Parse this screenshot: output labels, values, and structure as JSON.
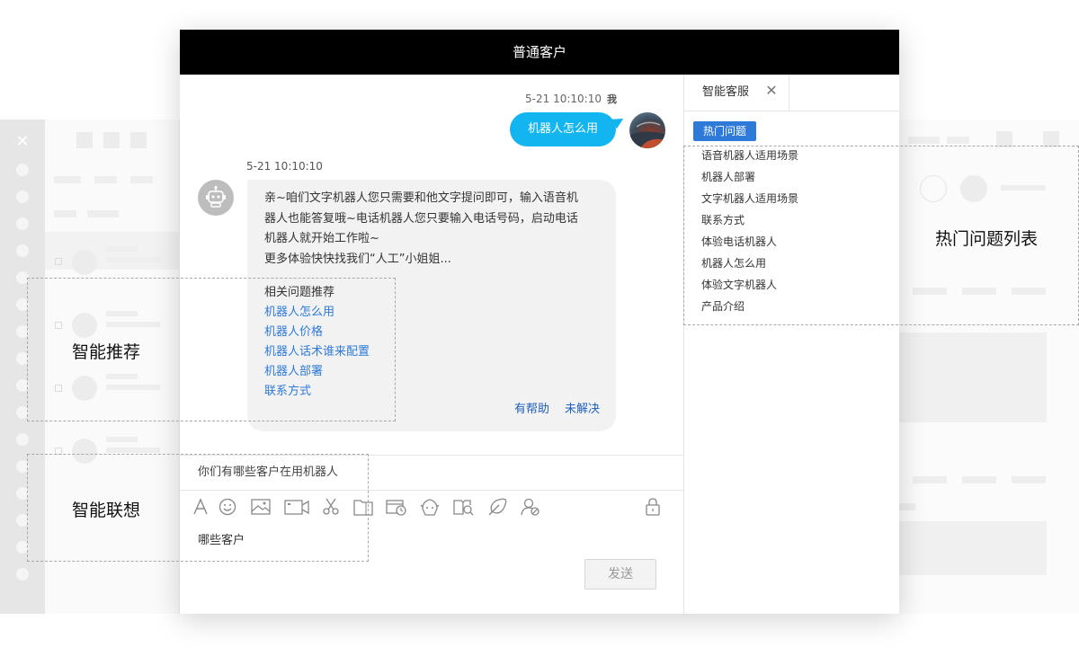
{
  "window": {
    "title": "普通客户"
  },
  "messages": {
    "me": {
      "time": "5-21 10:10:10",
      "sender": "我",
      "text": "机器人怎么用"
    },
    "bot": {
      "time": "5-21 10:10:10",
      "lines": [
        "亲~咱们文字机器人您只需要和他文字提问即可，输入语音机",
        "器人也能答复哦~电话机器人您只要输入电话号码，启动电话",
        "机器人就开始工作啦~",
        "更多体验快快找我们“人工”小姐姐..."
      ],
      "related_title": "相关问题推荐",
      "related": [
        "机器人怎么用",
        "机器人价格",
        "机器人话术谁来配置",
        "机器人部署",
        "联系方式"
      ],
      "helpful": "有帮助",
      "unsolved": "未解决"
    }
  },
  "association": {
    "suggestion": "你们有哪些客户在用机器人"
  },
  "toolbar": {
    "icons": [
      "font-icon",
      "emoji-icon",
      "image-icon",
      "video-icon",
      "scissors-icon",
      "folder-icon",
      "history-icon",
      "bot-icon",
      "knowledge-icon",
      "evaluate-icon",
      "transfer-icon",
      "lock-icon"
    ]
  },
  "input": {
    "value": "哪些客户"
  },
  "send": {
    "label": "发送"
  },
  "right_panel": {
    "tab": "智能客服",
    "badge": "热门问题",
    "items": [
      "语音机器人适用场景",
      "机器人部署",
      "文字机器人适用场景",
      "联系方式",
      "体验电话机器人",
      "机器人怎么用",
      "体验文字机器人",
      "产品介绍"
    ]
  },
  "annotations": {
    "recommend": "智能推荐",
    "associate": "智能联想",
    "hot_list": "热门问题列表"
  },
  "colors": {
    "accent": "#2e7ad9",
    "bubble_me": "#12b5f0",
    "title_bar": "#000000"
  }
}
